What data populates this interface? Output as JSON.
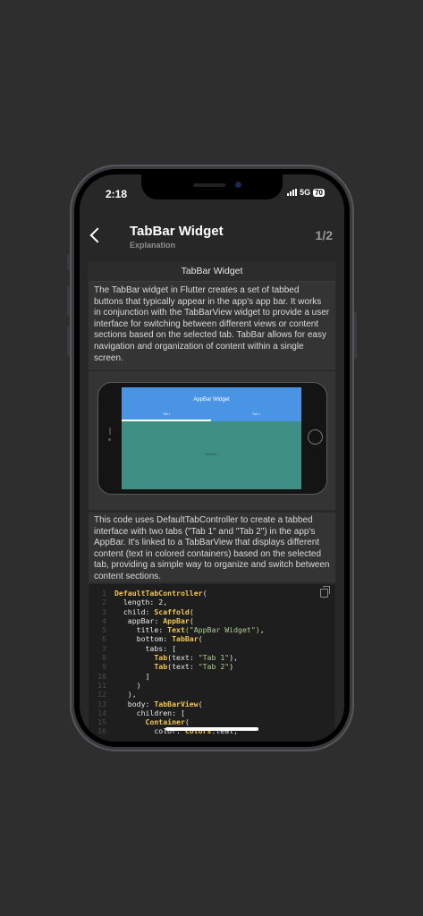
{
  "status": {
    "time": "2:18",
    "network": "5G",
    "battery": "70"
  },
  "header": {
    "title": "TabBar Widget",
    "subtitle": "Explanation",
    "page_indicator": "1/2"
  },
  "card1": {
    "heading": "TabBar Widget",
    "description": "The TabBar widget in Flutter creates a set of tabbed buttons that typically appear in the app's app bar. It works in conjunction with the TabBarView widget to provide a user interface for switching between different views or content sections based on the selected tab. TabBar allows for easy navigation and organization of content within a single screen."
  },
  "preview": {
    "appbar_title": "AppBar Widget",
    "tab1": "Tab 1",
    "tab2": "Tab 2",
    "body_text": "Content 1"
  },
  "card2": {
    "description": "This code uses DefaultTabController to create a tabbed interface with two tabs (\"Tab 1\" and \"Tab 2\") in the app's AppBar. It's linked to a TabBarView that displays different content (text in colored containers) based on the selected tab, providing a simple way to organize and switch between content sections."
  },
  "code_lines": [
    {
      "n": "1",
      "tokens": [
        {
          "c": "k",
          "v": "DefaultTabController"
        },
        {
          "c": "t",
          "v": "("
        }
      ]
    },
    {
      "n": "2",
      "tokens": [
        {
          "c": "t",
          "v": "  length: 2,"
        }
      ]
    },
    {
      "n": "3",
      "tokens": [
        {
          "c": "t",
          "v": "  child: "
        },
        {
          "c": "k",
          "v": "Scaffold"
        },
        {
          "c": "t",
          "v": "("
        }
      ]
    },
    {
      "n": "4",
      "tokens": [
        {
          "c": "t",
          "v": "   appBar: "
        },
        {
          "c": "k",
          "v": "AppBar"
        },
        {
          "c": "t",
          "v": "("
        }
      ]
    },
    {
      "n": "5",
      "tokens": [
        {
          "c": "t",
          "v": "     title: "
        },
        {
          "c": "k",
          "v": "Text"
        },
        {
          "c": "s",
          "v": "(\"AppBar Widget\")"
        },
        {
          "c": "t",
          "v": ","
        }
      ]
    },
    {
      "n": "6",
      "tokens": [
        {
          "c": "t",
          "v": "     bottom: "
        },
        {
          "c": "k",
          "v": "TabBar"
        },
        {
          "c": "t",
          "v": "("
        }
      ]
    },
    {
      "n": "7",
      "tokens": [
        {
          "c": "t",
          "v": "       tabs: ["
        }
      ]
    },
    {
      "n": "8",
      "tokens": [
        {
          "c": "t",
          "v": "         "
        },
        {
          "c": "k",
          "v": "Tab"
        },
        {
          "c": "t",
          "v": "(text: "
        },
        {
          "c": "s",
          "v": "\"Tab 1\""
        },
        {
          "c": "t",
          "v": "),"
        }
      ]
    },
    {
      "n": "9",
      "tokens": [
        {
          "c": "t",
          "v": "         "
        },
        {
          "c": "k",
          "v": "Tab"
        },
        {
          "c": "t",
          "v": "(text: "
        },
        {
          "c": "s",
          "v": "\"Tab 2\""
        },
        {
          "c": "t",
          "v": ")"
        }
      ]
    },
    {
      "n": "10",
      "tokens": [
        {
          "c": "t",
          "v": "       ]"
        }
      ]
    },
    {
      "n": "11",
      "tokens": [
        {
          "c": "t",
          "v": "     )"
        }
      ]
    },
    {
      "n": "12",
      "tokens": [
        {
          "c": "t",
          "v": "   ),"
        }
      ]
    },
    {
      "n": "13",
      "tokens": [
        {
          "c": "t",
          "v": "   body: "
        },
        {
          "c": "k",
          "v": "TabBarView"
        },
        {
          "c": "t",
          "v": "("
        }
      ]
    },
    {
      "n": "14",
      "tokens": [
        {
          "c": "t",
          "v": "     children: ["
        }
      ]
    },
    {
      "n": "15",
      "tokens": [
        {
          "c": "t",
          "v": "       "
        },
        {
          "c": "k",
          "v": "Container"
        },
        {
          "c": "t",
          "v": "("
        }
      ]
    },
    {
      "n": "16",
      "tokens": [
        {
          "c": "t",
          "v": "         color: "
        },
        {
          "c": "k",
          "v": "Colors"
        },
        {
          "c": "t",
          "v": ".teal,"
        }
      ]
    }
  ],
  "colors": {
    "background": "#2e2e2e",
    "screen": "#272727",
    "appbar_blue": "#4a94e6",
    "preview_teal": "#3f8f85",
    "keyword": "#f2c54f",
    "string": "#a8d08d"
  },
  "icons": {
    "back": "chevron-left-icon",
    "copy": "copy-icon",
    "signal": "signal-icon",
    "battery": "battery-icon"
  }
}
